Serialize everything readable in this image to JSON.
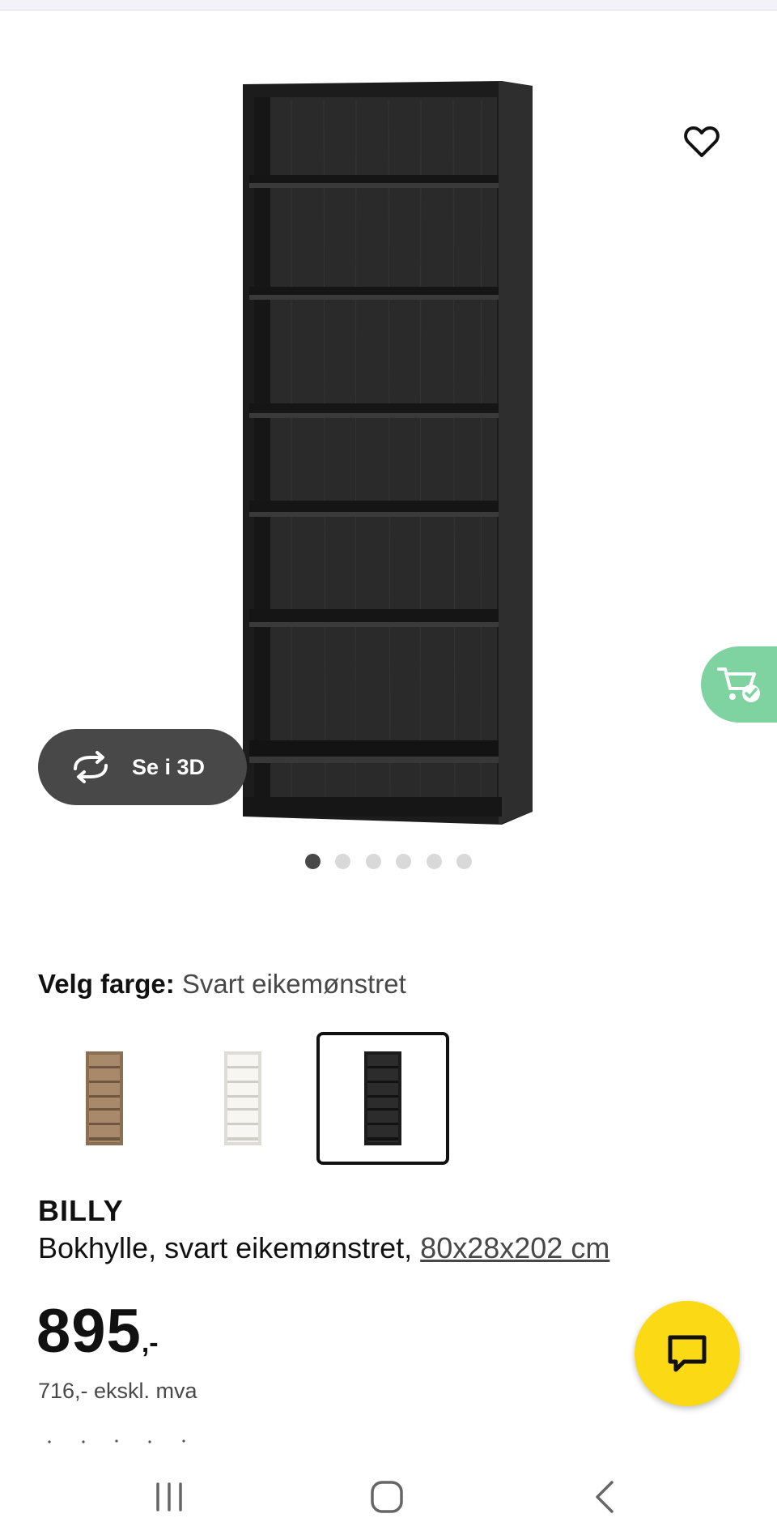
{
  "product": {
    "name": "BILLY",
    "description": "Bokhylle, svart eikemønstret,",
    "size_link": "80x28x202 cm",
    "price_main": "895",
    "price_suffix": ",-",
    "price_ex_vat": "716,- ekskl. mva"
  },
  "gallery": {
    "view_3d_label": "Se i 3D",
    "image_count": 6,
    "active_index": 0
  },
  "color_picker": {
    "label": "Velg farge:",
    "selected_value": "Svart eikemønstret",
    "options": [
      "brown-oak",
      "white",
      "black-oak"
    ],
    "selected_index": 2
  },
  "icons": {
    "favorite": "heart-icon",
    "view_3d": "rotate-3d-icon",
    "cart": "cart-added-icon",
    "chat": "chat-bubble-icon",
    "nav_recents": "recents-icon",
    "nav_home": "home-icon",
    "nav_back": "back-icon"
  },
  "colors": {
    "chat_button": "#fbd914",
    "cart_tab": "#7fd3a0",
    "dark_button": "#484848",
    "shelf_black": "#222222"
  }
}
